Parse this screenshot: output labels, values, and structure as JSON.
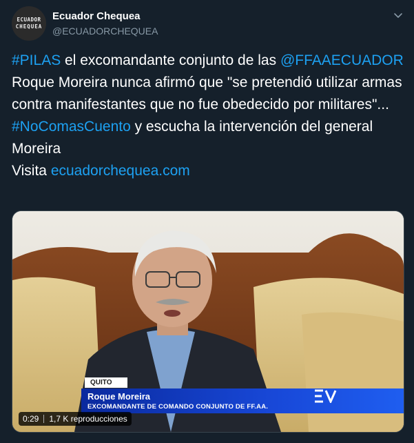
{
  "tweet": {
    "author": {
      "name": "Ecuador Chequea",
      "handle": "@ECUADORCHEQUEA",
      "avatar_line1": "ECUADOR",
      "avatar_line2": "CHEQUEA"
    },
    "text": {
      "hashtag_pilas": "#PILAS",
      "seg1": " el excomandante conjunto de las ",
      "mention": "@FFAAECUADOR",
      "seg2": " Roque Moreira nunca afirmó que \"se pretendió utilizar armas contra manifestantes que no fue obedecido por militares\"...",
      "hashtag_nocomas": "#NoComasCuento",
      "seg3": " y escucha la intervención del general Moreira",
      "visit_label": "Visita ",
      "url": "ecuadorchequea.com"
    },
    "video": {
      "location_tag": "QUITO",
      "person_name": "Roque Moreira",
      "person_role": "EXCOMANDANTE DE COMANDO CONJUNTO DE FF.AA.",
      "duration": "0:29",
      "views": "1,7 K reproducciones"
    },
    "colors": {
      "background": "#15202b",
      "link": "#1da1f2",
      "secondary_text": "#8899a6",
      "lower_third_blue": "#1848d8"
    },
    "icons": {
      "menu": "chevron-down-icon"
    }
  }
}
